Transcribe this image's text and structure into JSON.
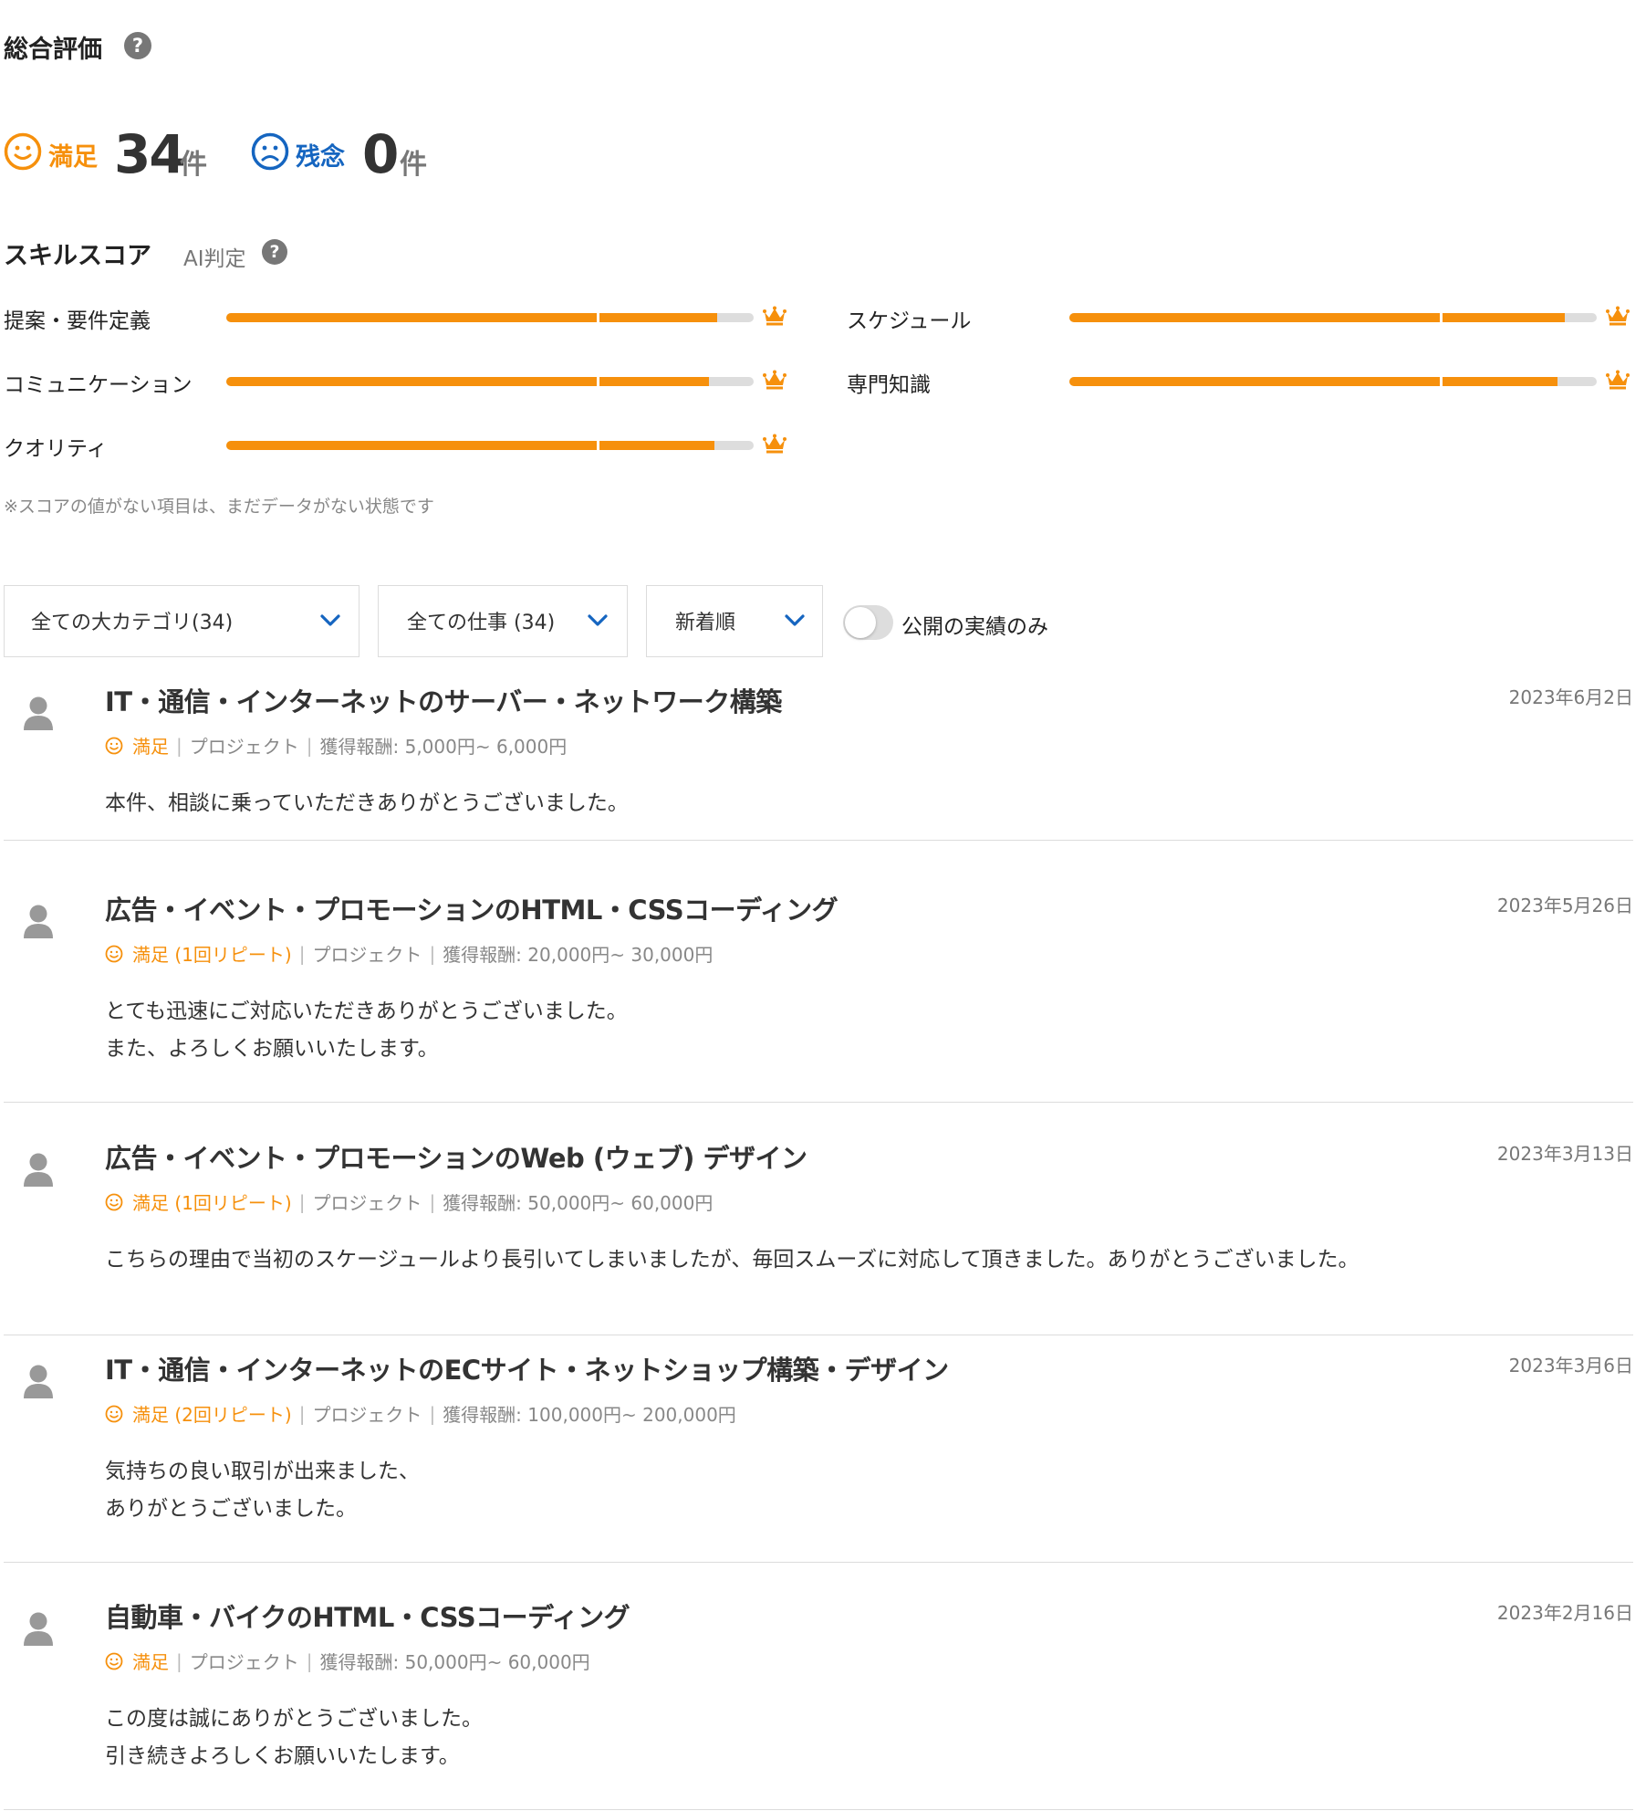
{
  "overall": {
    "title": "総合評価",
    "help": "?",
    "satisfied": {
      "label": "満足",
      "count": "34",
      "unit": "件"
    },
    "disappointed": {
      "label": "残念",
      "count": "0",
      "unit": "件"
    }
  },
  "skill": {
    "title": "スキルスコア",
    "ai": "AI判定",
    "help": "?",
    "items": [
      {
        "label": "提案・要件定義",
        "score": 0.93
      },
      {
        "label": "スケジュール",
        "score": 0.94
      },
      {
        "label": "コミュニケーション",
        "score": 0.915
      },
      {
        "label": "専門知識",
        "score": 0.925
      },
      {
        "label": "クオリティ",
        "score": 0.925
      }
    ],
    "note": "※スコアの値がない項目は、まだデータがない状態です"
  },
  "filters": {
    "category": "全ての大カテゴリ(34)",
    "jobs": "全ての仕事 (34)",
    "sort": "新着順",
    "public_only": "公開の実績のみ",
    "public_only_on": false
  },
  "reviews": [
    {
      "title": "IT・通信・インターネットのサーバー・ネットワーク構築",
      "date": "2023年6月2日",
      "rating": "満足",
      "type": "プロジェクト",
      "reward": "獲得報酬: 5,000円~ 6,000円",
      "comment": [
        "本件、相談に乗っていただきありがとうございました。"
      ]
    },
    {
      "title": "広告・イベント・プロモーションのHTML・CSSコーディング",
      "date": "2023年5月26日",
      "rating": "満足 (1回リピート)",
      "type": "プロジェクト",
      "reward": "獲得報酬: 20,000円~ 30,000円",
      "comment": [
        "とても迅速にご対応いただきありがとうございました。",
        "また、よろしくお願いいたします。"
      ]
    },
    {
      "title": "広告・イベント・プロモーションのWeb (ウェブ) デザイン",
      "date": "2023年3月13日",
      "rating": "満足 (1回リピート)",
      "type": "プロジェクト",
      "reward": "獲得報酬: 50,000円~ 60,000円",
      "comment": [
        "こちらの理由で当初のスケージュールより長引いてしまいましたが、毎回スムーズに対応して頂きました。ありがとうございました。"
      ]
    },
    {
      "title": "IT・通信・インターネットのECサイト・ネットショップ構築・デザイン",
      "date": "2023年3月6日",
      "rating": "満足 (2回リピート)",
      "type": "プロジェクト",
      "reward": "獲得報酬: 100,000円~ 200,000円",
      "comment": [
        "気持ちの良い取引が出来ました、",
        "ありがとうございました。"
      ]
    },
    {
      "title": "自動車・バイクのHTML・CSSコーディング",
      "date": "2023年2月16日",
      "rating": "満足",
      "type": "プロジェクト",
      "reward": "獲得報酬: 50,000円~ 60,000円",
      "comment": [
        "この度は誠にありがとうございました。",
        "引き続きよろしくお願いいたします。"
      ]
    }
  ],
  "colors": {
    "accent": "#f6900c",
    "blue": "#1565c0",
    "track": "#dddddd"
  },
  "icons": {
    "help": "question-circle-icon",
    "smile": "smile-icon",
    "sad": "sad-icon",
    "crown": "crown-icon",
    "chevron": "chevron-down-icon",
    "avatar": "user-icon"
  }
}
